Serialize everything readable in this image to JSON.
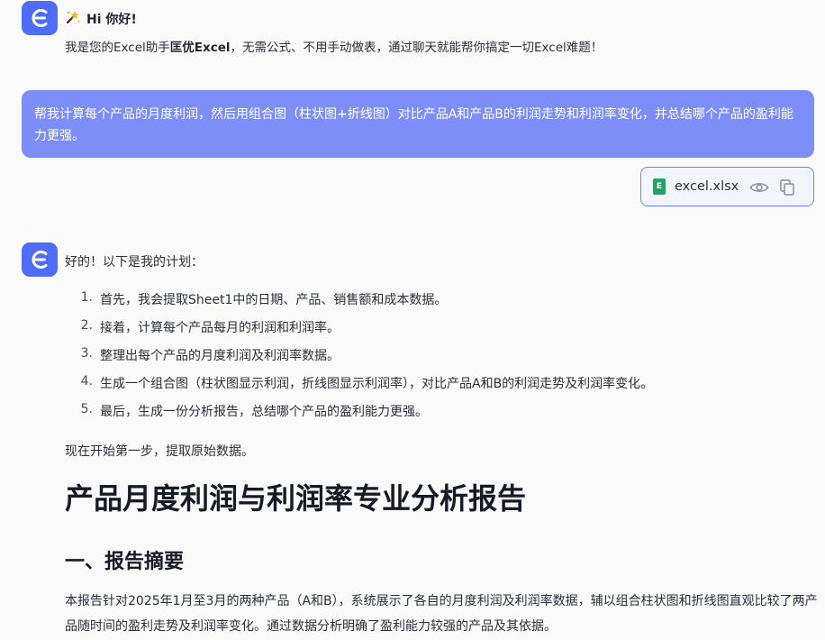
{
  "greeting": {
    "icon": "sparkle-wand-icon",
    "title": "Hi 你好!",
    "sub_prefix": "我是您的Excel助手",
    "sub_brand": "匡优Excel",
    "sub_suffix": "，无需公式、不用手动做表，通过聊天就能帮你搞定一切Excel难题！"
  },
  "user_message": {
    "text": "帮我计算每个产品的月度利润，然后用组合图（柱状图+折线图）对比产品A和产品B的利润走势和利润率变化，并总结哪个产品的盈利能力更强。"
  },
  "attachment": {
    "badge": "E",
    "file_name": "excel.xlsx",
    "preview_icon": "eye-icon",
    "copy_icon": "copy-icon"
  },
  "assistant": {
    "intro": "好的！以下是我的计划：",
    "plan": [
      {
        "num": "1.",
        "text": "首先，我会提取Sheet1中的日期、产品、销售额和成本数据。"
      },
      {
        "num": "2.",
        "text": "接着，计算每个产品每月的利润和利润率。"
      },
      {
        "num": "3.",
        "text": "整理出每个产品的月度利润及利润率数据。"
      },
      {
        "num": "4.",
        "text": "生成一个组合图（柱状图显示利润，折线图显示利润率），对比产品A和B的利润走势及利润率变化。"
      },
      {
        "num": "5.",
        "text": "最后，生成一份分析报告，总结哪个产品的盈利能力更强。"
      }
    ],
    "start_line": "现在开始第一步，提取原始数据。",
    "report_title": "产品月度利润与利润率专业分析报告",
    "section_title": "一、报告摘要",
    "section_body": "本报告针对2025年1月至3月的两种产品（A和B），系统展示了各自的月度利润及利润率数据，辅以组合柱状图和折线图直观比较了两产品随时间的盈利走势及利润率变化。通过数据分析明确了盈利能力较强的产品及其依据。"
  },
  "colors": {
    "brand": "#4f6cf7",
    "user_bubble": "#7d8ef8",
    "excel_green": "#21a366"
  }
}
